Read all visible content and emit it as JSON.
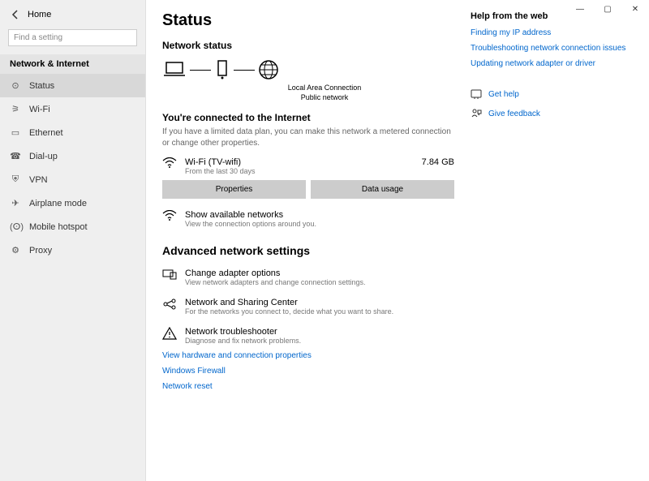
{
  "titlebar": {
    "minimize": "—",
    "maximize": "▢",
    "close": "✕"
  },
  "sidebar": {
    "home": "Home",
    "search_placeholder": "Find a setting",
    "section": "Network & Internet",
    "items": [
      {
        "label": "Status"
      },
      {
        "label": "Wi-Fi"
      },
      {
        "label": "Ethernet"
      },
      {
        "label": "Dial-up"
      },
      {
        "label": "VPN"
      },
      {
        "label": "Airplane mode"
      },
      {
        "label": "Mobile hotspot"
      },
      {
        "label": "Proxy"
      }
    ]
  },
  "page": {
    "title": "Status",
    "network_status_heading": "Network status",
    "diagram_caption_line1": "Local Area Connection",
    "diagram_caption_line2": "Public network",
    "connected_heading": "You're connected to the Internet",
    "connected_desc": "If you have a limited data plan, you can make this network a metered connection or change other properties.",
    "connection": {
      "name": "Wi-Fi (TV-wifi)",
      "sub": "From the last 30 days",
      "usage": "7.84 GB"
    },
    "buttons": {
      "properties": "Properties",
      "data_usage": "Data usage"
    },
    "show_networks": {
      "title": "Show available networks",
      "desc": "View the connection options around you."
    },
    "advanced_heading": "Advanced network settings",
    "adv_items": [
      {
        "title": "Change adapter options",
        "desc": "View network adapters and change connection settings."
      },
      {
        "title": "Network and Sharing Center",
        "desc": "For the networks you connect to, decide what you want to share."
      },
      {
        "title": "Network troubleshooter",
        "desc": "Diagnose and fix network problems."
      }
    ],
    "links": [
      "View hardware and connection properties",
      "Windows Firewall",
      "Network reset"
    ]
  },
  "help": {
    "heading": "Help from the web",
    "links": [
      "Finding my IP address",
      "Troubleshooting network connection issues",
      "Updating network adapter or driver"
    ],
    "get_help": "Get help",
    "give_feedback": "Give feedback"
  }
}
